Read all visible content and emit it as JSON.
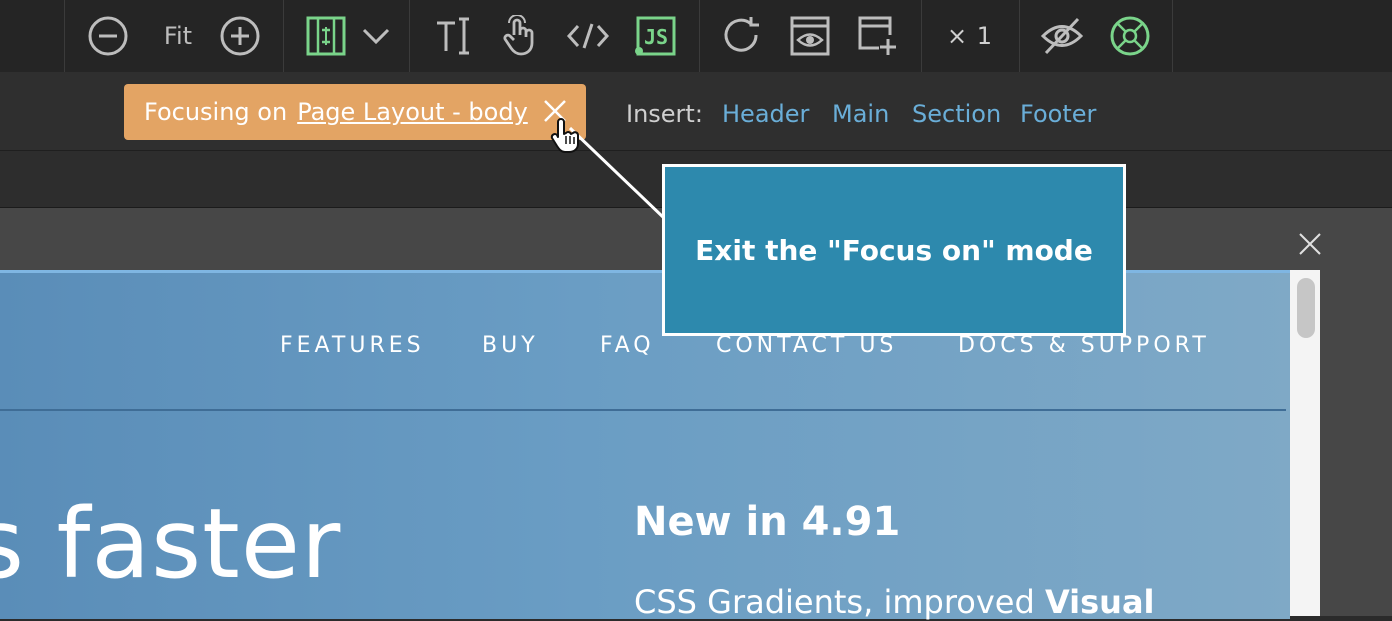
{
  "toolbar": {
    "zoom_fit_label": "Fit",
    "multiplier_label": "× 1",
    "icons": {
      "zoom_out": "minus-circle-icon",
      "zoom_in": "plus-circle-icon",
      "layout": "layout-grid-icon",
      "layout_dropdown": "chevron-down-icon",
      "text": "text-cursor-icon",
      "interactions": "hand-touch-icon",
      "code": "code-icon",
      "js": "js-icon",
      "refresh": "refresh-icon",
      "preview": "preview-eye-icon",
      "add_page": "add-page-icon",
      "visibility": "eye-off-icon",
      "focus": "focus-target-icon"
    },
    "colors": {
      "accent_green": "#7ad48a",
      "icon_gray": "#bdbdbd"
    }
  },
  "insertbar": {
    "focus_prefix": "Focusing on",
    "focus_target": "Page Layout - body",
    "insert_label": "Insert:",
    "insert_links": [
      "Header",
      "Main",
      "Section",
      "Footer"
    ],
    "colors": {
      "focus_bg": "#e3a464",
      "link": "#6aaed8"
    }
  },
  "preview": {
    "nav": [
      "FEATURES",
      "BUY",
      "FAQ",
      "CONTACT US",
      "DOCS & SUPPORT"
    ],
    "hero_text": "s faster",
    "new_title": "New in 4.91",
    "new_desc_prefix": "CSS Gradients, improved",
    "new_desc_bold": "Visual"
  },
  "tooltip": {
    "text": "Exit the \"Focus on\" mode",
    "colors": {
      "bg": "#2d89ad",
      "border": "#ffffff"
    }
  }
}
